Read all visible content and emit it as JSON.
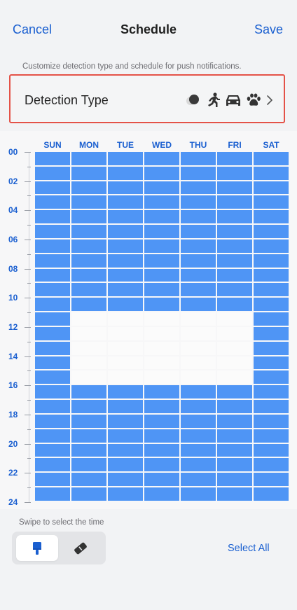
{
  "header": {
    "cancel_label": "Cancel",
    "title": "Schedule",
    "save_label": "Save"
  },
  "hint_text": "Customize detection type and schedule for push notifications.",
  "detection": {
    "label": "Detection Type",
    "icons": [
      "motion-dot-icon",
      "person-running-icon",
      "car-icon",
      "paw-icon",
      "chevron-right-icon"
    ]
  },
  "schedule": {
    "days": [
      "SUN",
      "MON",
      "TUE",
      "WED",
      "THU",
      "FRI",
      "SAT"
    ],
    "hour_labels": [
      "00",
      "02",
      "04",
      "06",
      "08",
      "10",
      "12",
      "14",
      "16",
      "18",
      "20",
      "22",
      "24"
    ],
    "selected_color": "#4f95f5",
    "unselected_color": "#fbfbfb",
    "unselected_ranges": [
      {
        "days": [
          "MON",
          "TUE",
          "WED",
          "THU",
          "FRI"
        ],
        "from_hour": 11,
        "to_hour": 16
      }
    ]
  },
  "footer": {
    "swipe_hint": "Swipe to select the time",
    "modes": [
      {
        "name": "brush",
        "icon": "brush-icon",
        "active": true
      },
      {
        "name": "eraser",
        "icon": "eraser-icon",
        "active": false
      }
    ],
    "select_all_label": "Select All"
  },
  "colors": {
    "accent": "#1a5fd0",
    "highlight_border": "#e45248"
  }
}
